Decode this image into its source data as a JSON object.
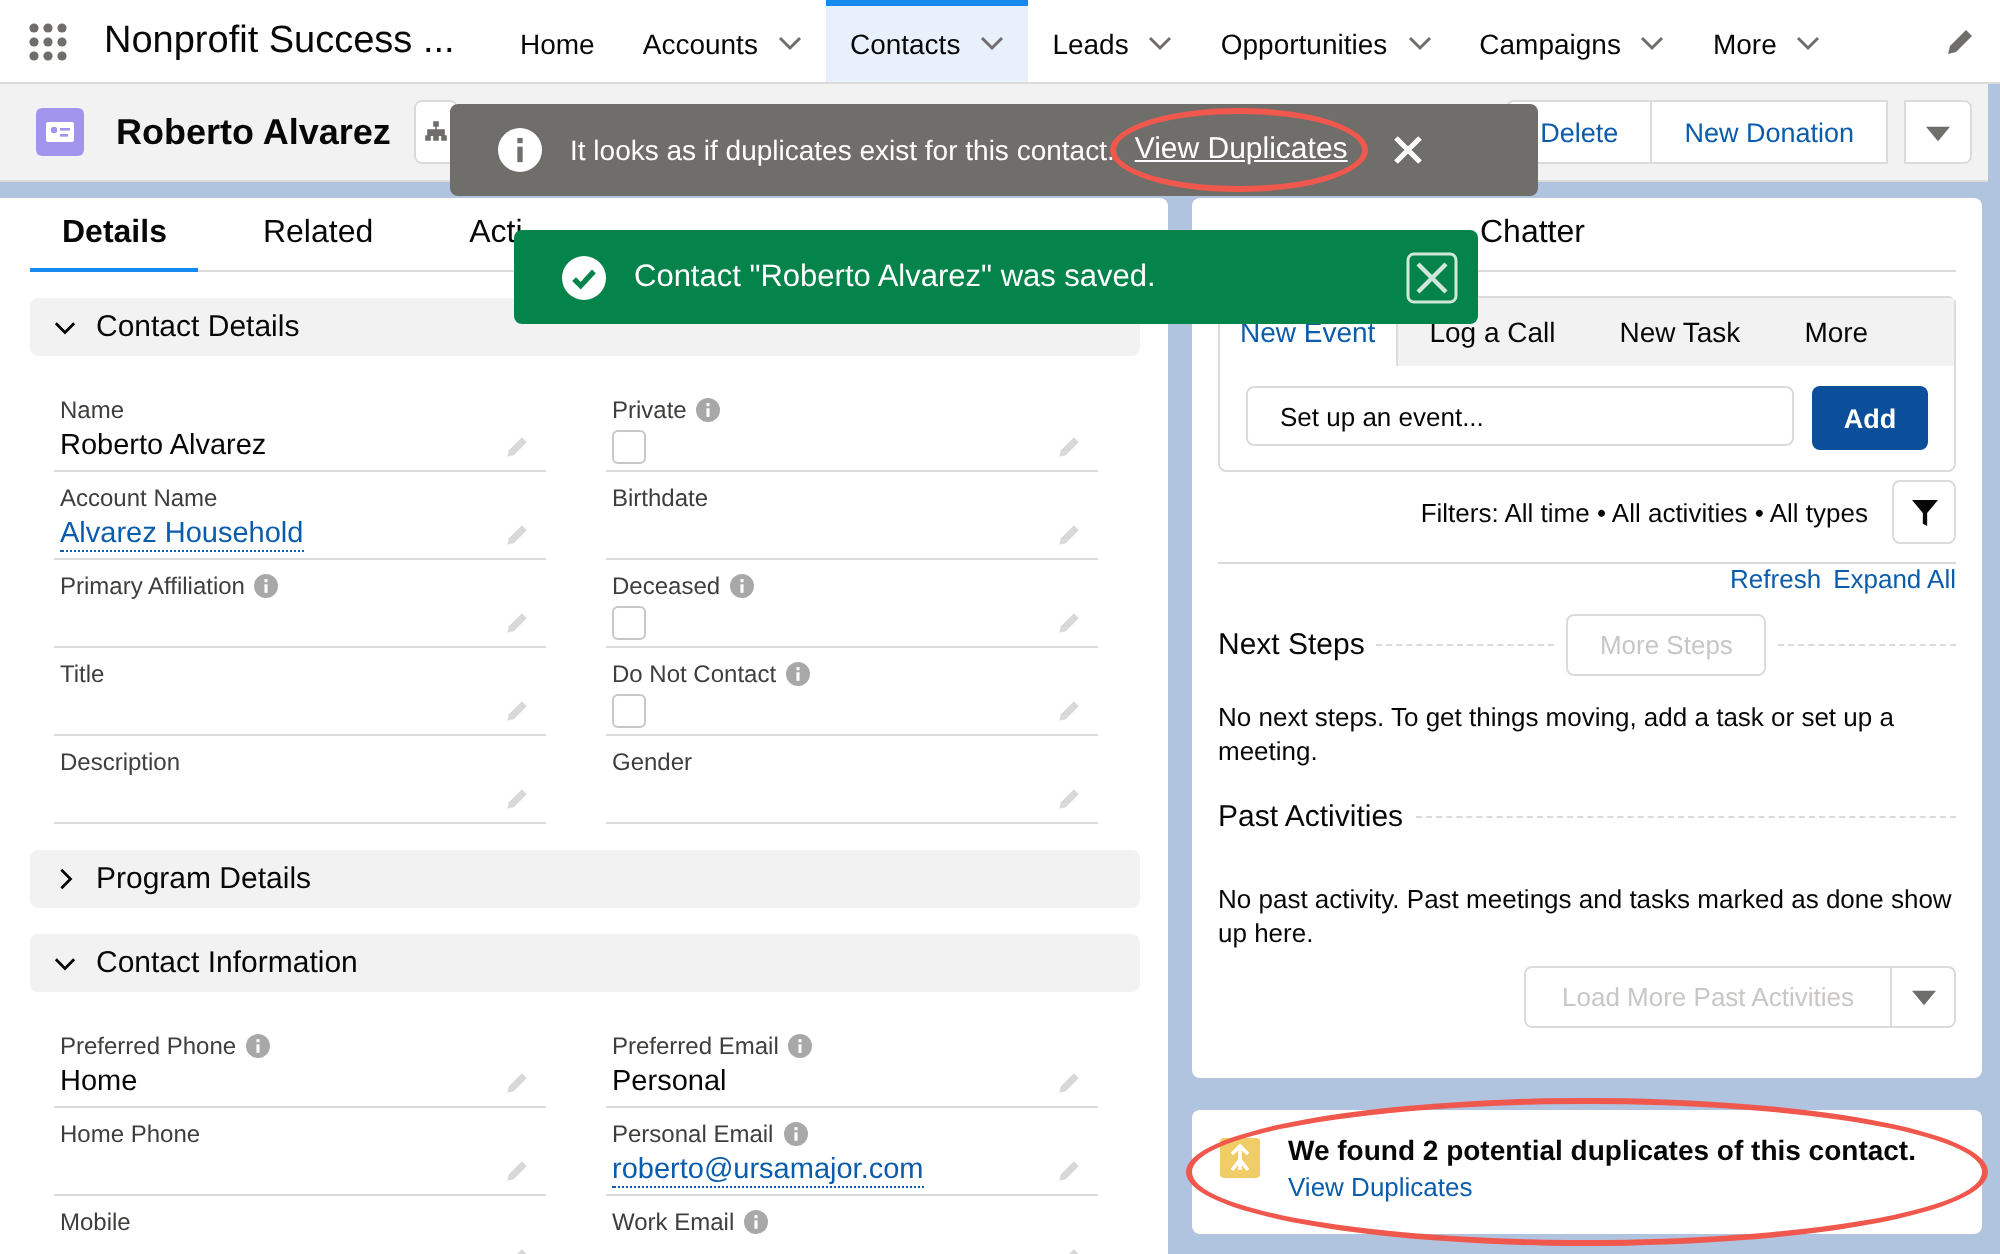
{
  "nav": {
    "app_name": "Nonprofit Success ...",
    "items": [
      {
        "label": "Home",
        "dropdown": false,
        "selected": false
      },
      {
        "label": "Accounts",
        "dropdown": true,
        "selected": false
      },
      {
        "label": "Contacts",
        "dropdown": true,
        "selected": true
      },
      {
        "label": "Leads",
        "dropdown": true,
        "selected": false
      },
      {
        "label": "Opportunities",
        "dropdown": true,
        "selected": false
      },
      {
        "label": "Campaigns",
        "dropdown": true,
        "selected": false
      },
      {
        "label": "More",
        "dropdown": true,
        "selected": false
      }
    ]
  },
  "record": {
    "name": "Roberto Alvarez",
    "buttons": [
      "Delete",
      "New Donation"
    ]
  },
  "left_tabs": [
    {
      "label": "Details",
      "selected": true
    },
    {
      "label": "Related",
      "selected": false
    },
    {
      "label": "Acti",
      "selected": false
    }
  ],
  "sections": [
    {
      "title": "Contact Details",
      "expanded": true,
      "fields": [
        {
          "label": "Name",
          "info": false,
          "kind": "text",
          "value": "Roberto Alvarez"
        },
        {
          "label": "Private",
          "info": true,
          "kind": "checkbox",
          "checked": false
        },
        {
          "label": "Account Name",
          "info": false,
          "kind": "link",
          "value": "Alvarez Household"
        },
        {
          "label": "Birthdate",
          "info": false,
          "kind": "text"
        },
        {
          "label": "Primary Affiliation",
          "info": true,
          "kind": "text"
        },
        {
          "label": "Deceased",
          "info": true,
          "kind": "checkbox",
          "checked": false
        },
        {
          "label": "Title",
          "info": false,
          "kind": "text"
        },
        {
          "label": "Do Not Contact",
          "info": true,
          "kind": "checkbox",
          "checked": false
        },
        {
          "label": "Description",
          "info": false,
          "kind": "text"
        },
        {
          "label": "Gender",
          "info": false,
          "kind": "text"
        }
      ]
    },
    {
      "title": "Program Details",
      "expanded": false
    },
    {
      "title": "Contact Information",
      "expanded": true,
      "fields": [
        {
          "label": "Preferred Phone",
          "info": true,
          "kind": "text",
          "value": "Home"
        },
        {
          "label": "Preferred Email",
          "info": true,
          "kind": "text",
          "value": "Personal"
        },
        {
          "label": "Home Phone",
          "info": false,
          "kind": "text"
        },
        {
          "label": "Personal Email",
          "info": true,
          "kind": "link",
          "value": "roberto@ursamajor.com"
        },
        {
          "label": "Mobile",
          "info": false,
          "kind": "text"
        },
        {
          "label": "Work Email",
          "info": true,
          "kind": "text"
        }
      ]
    }
  ],
  "right_tabs": [
    {
      "label": "Chatter",
      "selected": false
    }
  ],
  "composer": {
    "tabs": [
      {
        "label": "New Event",
        "selected": true
      },
      {
        "label": "Log a Call",
        "selected": false
      },
      {
        "label": "New Task",
        "selected": false
      },
      {
        "label": "More",
        "selected": false
      }
    ],
    "placeholder": "Set up an event...",
    "add": "Add"
  },
  "filters": "Filters: All time • All activities • All types",
  "links": [
    "Refresh",
    "Expand All"
  ],
  "next_steps": {
    "heading": "Next Steps",
    "button": "More Steps",
    "disabled": true,
    "text": "No next steps. To get things moving, add a task or set up a meeting."
  },
  "past": {
    "heading": "Past Activities",
    "text": "No past activity. Past meetings and tasks marked as done show up here.",
    "button": "Load More Past Activities",
    "disabled": true
  },
  "duplicates": {
    "message": "We found 2 potential duplicates of this contact.",
    "link": "View Duplicates"
  },
  "toasts": [
    {
      "kind": "info",
      "message": "It looks as if duplicates exist for this contact.",
      "link": "View Duplicates"
    },
    {
      "kind": "success",
      "message": "Contact \"Roberto Alvarez\" was saved."
    }
  ]
}
